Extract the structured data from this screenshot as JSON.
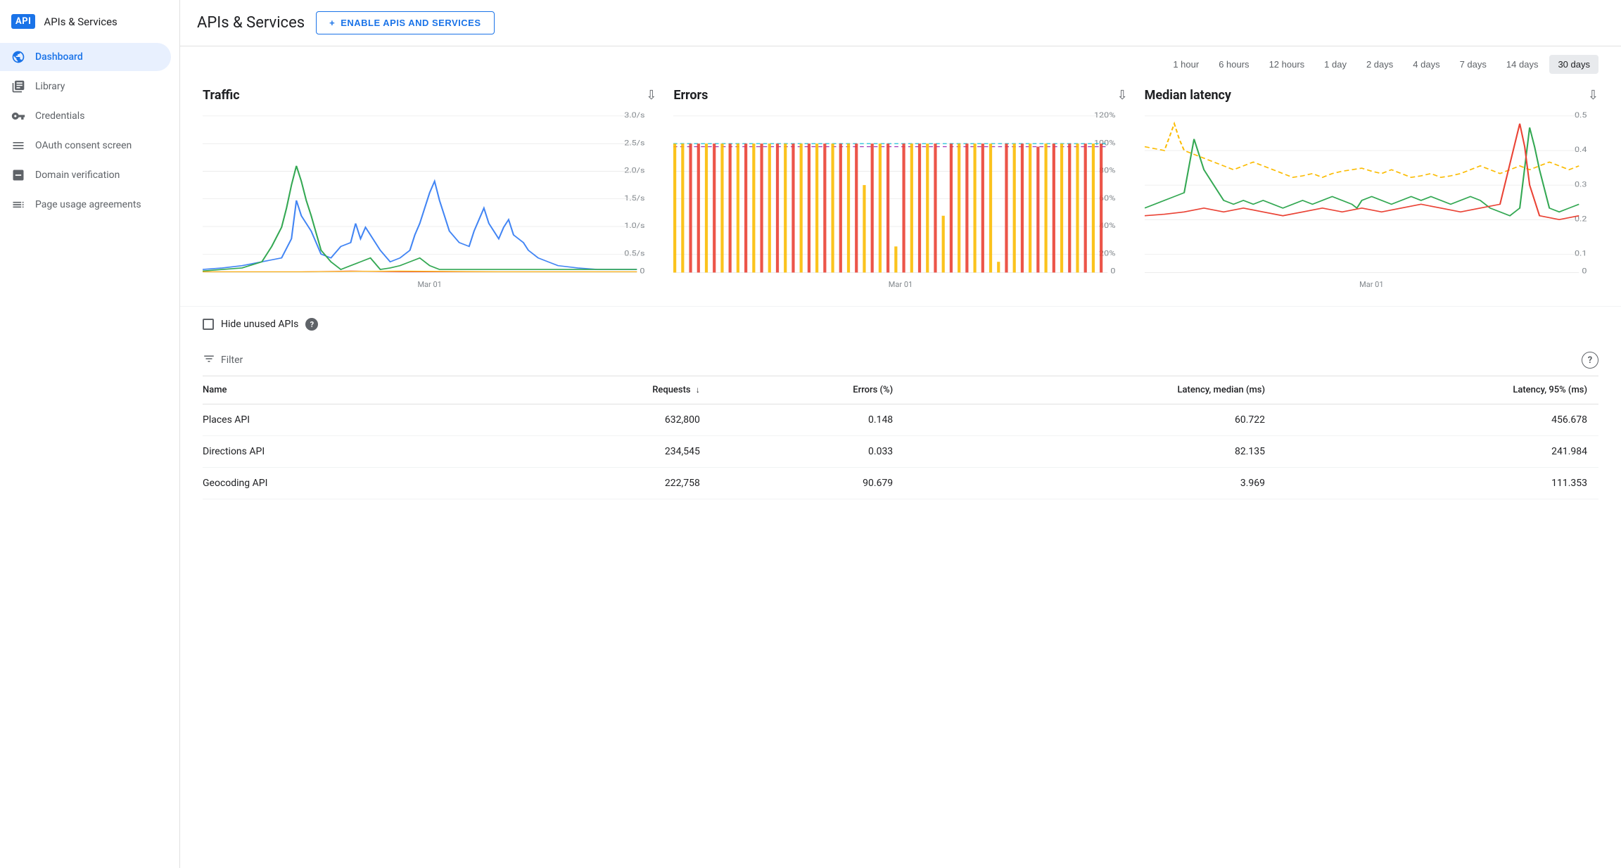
{
  "app": {
    "logo_text": "API",
    "sidebar_title": "APIs & Services",
    "main_title": "APIs & Services"
  },
  "enable_button": {
    "label": "ENABLE APIS AND SERVICES",
    "plus": "+"
  },
  "sidebar": {
    "items": [
      {
        "id": "dashboard",
        "label": "Dashboard",
        "icon": "⬡",
        "active": true
      },
      {
        "id": "library",
        "label": "Library",
        "icon": "▦",
        "active": false
      },
      {
        "id": "credentials",
        "label": "Credentials",
        "icon": "⚙",
        "active": false
      },
      {
        "id": "oauth",
        "label": "OAuth consent screen",
        "icon": "☰",
        "active": false
      },
      {
        "id": "domain",
        "label": "Domain verification",
        "icon": "☑",
        "active": false
      },
      {
        "id": "page-usage",
        "label": "Page usage agreements",
        "icon": "≡",
        "active": false
      }
    ]
  },
  "time_range": {
    "options": [
      {
        "label": "1 hour",
        "active": false
      },
      {
        "label": "6 hours",
        "active": false
      },
      {
        "label": "12 hours",
        "active": false
      },
      {
        "label": "1 day",
        "active": false
      },
      {
        "label": "2 days",
        "active": false
      },
      {
        "label": "4 days",
        "active": false
      },
      {
        "label": "7 days",
        "active": false
      },
      {
        "label": "14 days",
        "active": false
      },
      {
        "label": "30 days",
        "active": true
      }
    ]
  },
  "charts": [
    {
      "id": "traffic",
      "title": "Traffic",
      "x_label": "Mar 01",
      "y_max": "3.0/s",
      "y_labels": [
        "3.0/s",
        "2.5/s",
        "2.0/s",
        "1.5/s",
        "1.0/s",
        "0.5/s",
        "0"
      ]
    },
    {
      "id": "errors",
      "title": "Errors",
      "x_label": "Mar 01",
      "y_max": "120%",
      "y_labels": [
        "120%",
        "100%",
        "80%",
        "60%",
        "40%",
        "20%",
        "0"
      ]
    },
    {
      "id": "latency",
      "title": "Median latency",
      "x_label": "Mar 01",
      "y_max": "0.5",
      "y_labels": [
        "0.5",
        "0.4",
        "0.3",
        "0.2",
        "0.1",
        "0"
      ]
    }
  ],
  "hide_unused": {
    "label": "Hide unused APIs",
    "checked": false,
    "help": "?"
  },
  "filter": {
    "label": "Filter",
    "help": "?"
  },
  "table": {
    "columns": [
      {
        "label": "Name",
        "sort": false
      },
      {
        "label": "Requests",
        "sort": true
      },
      {
        "label": "Errors (%)",
        "sort": false
      },
      {
        "label": "Latency, median (ms)",
        "sort": false
      },
      {
        "label": "Latency, 95% (ms)",
        "sort": false
      }
    ],
    "rows": [
      {
        "name": "Places API",
        "requests": "632,800",
        "errors": "0.148",
        "latency_median": "60.722",
        "latency_95": "456.678"
      },
      {
        "name": "Directions API",
        "requests": "234,545",
        "errors": "0.033",
        "latency_median": "82.135",
        "latency_95": "241.984"
      },
      {
        "name": "Geocoding API",
        "requests": "222,758",
        "errors": "90.679",
        "latency_median": "3.969",
        "latency_95": "111.353"
      }
    ]
  },
  "colors": {
    "blue": "#1a73e8",
    "active_bg": "#e8f0fe",
    "border": "#e0e0e0",
    "chart_blue": "#4285f4",
    "chart_green": "#34a853",
    "chart_orange": "#fbbc04",
    "chart_red": "#ea4335",
    "chart_teal": "#00bcd4"
  }
}
